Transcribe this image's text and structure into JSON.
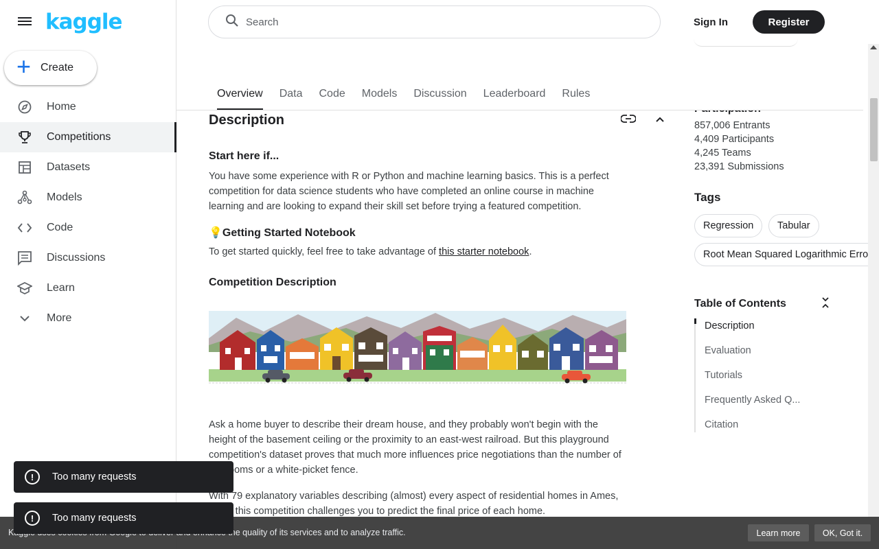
{
  "sidebar": {
    "logo": "kaggle",
    "create_label": "Create",
    "items": [
      {
        "label": "Home",
        "icon": "compass-icon"
      },
      {
        "label": "Competitions",
        "icon": "trophy-icon"
      },
      {
        "label": "Datasets",
        "icon": "table-icon"
      },
      {
        "label": "Models",
        "icon": "models-icon"
      },
      {
        "label": "Code",
        "icon": "code-icon"
      },
      {
        "label": "Discussions",
        "icon": "discussion-icon"
      },
      {
        "label": "Learn",
        "icon": "school-icon"
      },
      {
        "label": "More",
        "icon": "chevron-down-icon"
      }
    ],
    "active_item": "Competitions"
  },
  "header": {
    "search_placeholder": "Search",
    "signin_label": "Sign In",
    "register_label": "Register"
  },
  "tabs": [
    "Overview",
    "Data",
    "Code",
    "Models",
    "Discussion",
    "Leaderboard",
    "Rules"
  ],
  "active_tab": "Overview",
  "main": {
    "section_title": "Description",
    "start_heading": "Start here if...",
    "start_text": "You have some experience with R or Python and machine learning basics. This is a perfect competition for data science students who have completed an online course in machine learning and are looking to expand their skill set before trying a featured competition.",
    "notebook_emoji": "💡",
    "notebook_heading": "Getting Started Notebook",
    "notebook_text_before": "To get started quickly, feel free to take advantage of ",
    "notebook_link": "this starter notebook",
    "notebook_text_after": ".",
    "comp_heading": "Competition Description",
    "para1": "Ask a home buyer to describe their dream house, and they probably won't begin with the height of the basement ceiling or the proximity to an east-west railroad. But this playground competition's dataset proves that much more influences price negotiations than the number of bedrooms or a white-picket fence.",
    "para2": "With 79 explanatory variables describing (almost) every aspect of residential homes in Ames, Iowa, this competition challenges you to predict the final price of each home."
  },
  "right": {
    "participation_title": "Participation",
    "stats": [
      "857,006 Entrants",
      "4,409 Participants",
      "4,245 Teams",
      "23,391 Submissions"
    ],
    "tags_title": "Tags",
    "tags": [
      "Regression",
      "Tabular",
      "Root Mean Squared Logarithmic Error"
    ],
    "toc_title": "Table of Contents",
    "toc": [
      "Description",
      "Evaluation",
      "Tutorials",
      "Frequently Asked Q...",
      "Citation"
    ],
    "toc_active": "Description"
  },
  "toasts": [
    "Too many requests",
    "Too many requests"
  ],
  "cookie": {
    "text": "Kaggle uses cookies from Google to deliver and enhance the quality of its services and to analyze traffic.",
    "learn_more": "Learn more",
    "ok": "OK, Got it."
  },
  "colors": {
    "brand": "#20beff",
    "accent": "#1a73e8",
    "dark": "#202124"
  }
}
